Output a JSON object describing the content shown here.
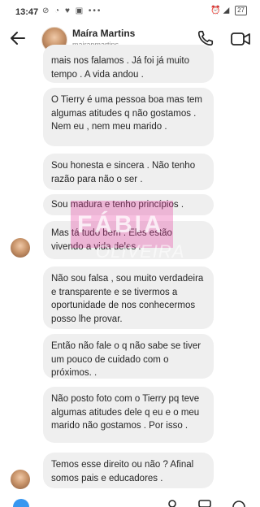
{
  "status": {
    "time": "13:47",
    "left_icons": "⊘ ◔ ♥ ▣ •••",
    "right_icons": "⏰ ◢",
    "battery": "27"
  },
  "header": {
    "name": "Maíra Martins",
    "handle": "mairapmartins"
  },
  "messages": [
    {
      "text": "mais nos falamos . Já foi já muito tempo . A vida andou ."
    },
    {
      "text": "O Tierry é uma pessoa boa mas tem algumas atitudes q não gostamos . Nem eu , nem meu marido ."
    },
    {
      "text": "Sou honesta e sincera . Não tenho razão para não o ser ."
    },
    {
      "text": "Sou madura e tenho princípios ."
    },
    {
      "text": "Mas tá tudo bem . Eles estão vivendo a vida deles ."
    },
    {
      "text": "Não sou falsa , sou muito verdadeira e transparente e se tivermos a oportunidade de nos conhecermos posso lhe provar."
    },
    {
      "text": "Então não fale o q não sabe se tiver um pouco de cuidado com o próximos. ."
    },
    {
      "text": "Não posto foto com o Tierry pq teve algumas atitudes dele q eu e o meu marido não gostamos . Por isso ."
    },
    {
      "text": "Temos esse direito ou não ? Afinal somos pais e educadores ."
    }
  ],
  "watermark": {
    "title": "FÁBIA",
    "subtitle": "OLIVEIRA"
  },
  "colors": {
    "bubble": "#efefef",
    "text": "#262626",
    "secondary": "#8e8e8e",
    "composer_accent": "#3797f0"
  }
}
